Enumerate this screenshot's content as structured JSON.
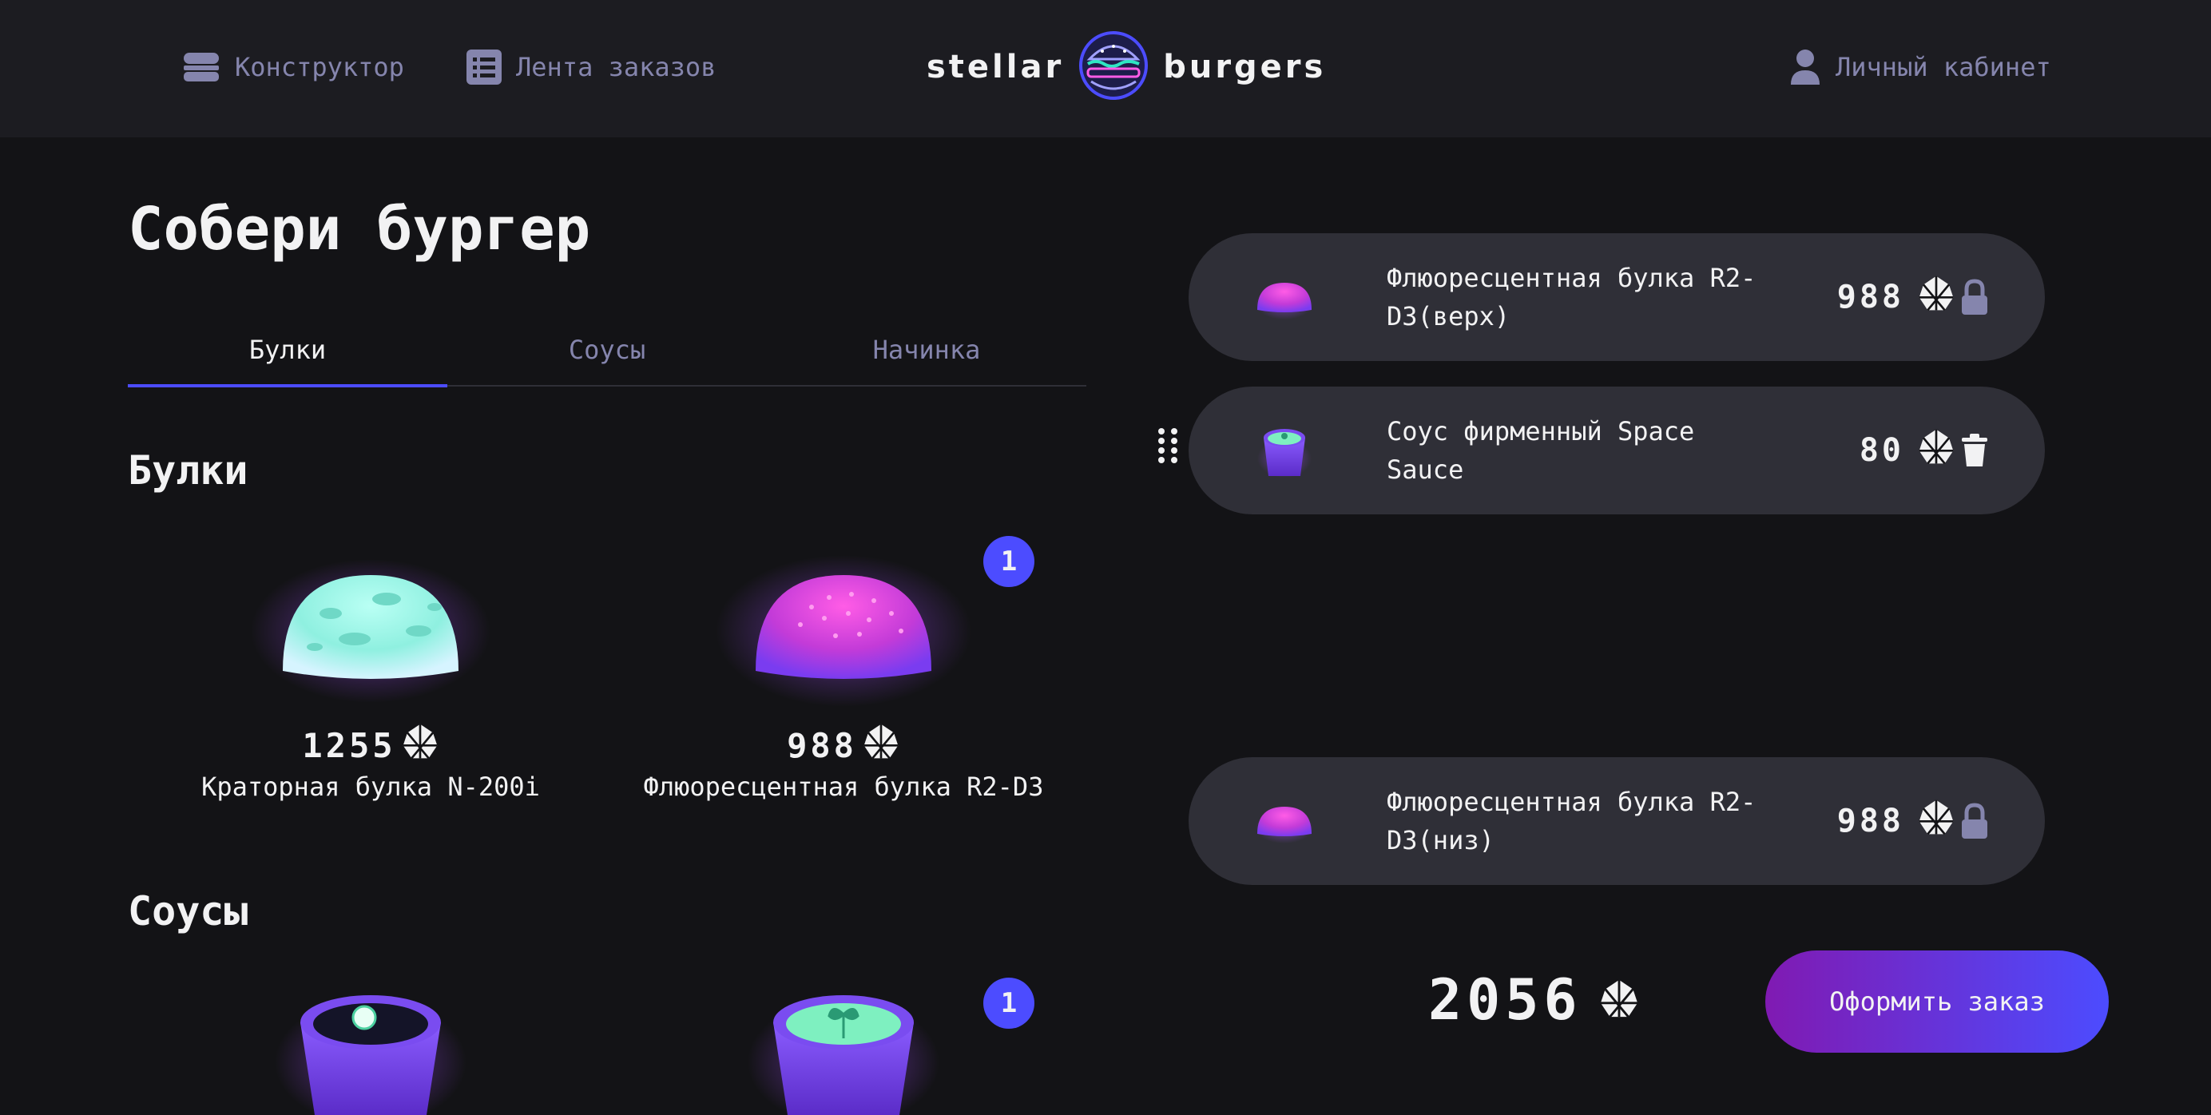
{
  "header": {
    "nav": [
      {
        "label": "Конструктор",
        "icon": "burger-icon"
      },
      {
        "label": "Лента заказов",
        "icon": "list-icon"
      }
    ],
    "logo": {
      "left": "stellar",
      "right": "burgers"
    },
    "account": {
      "label": "Личный кабинет",
      "icon": "profile-icon"
    }
  },
  "page_title": "Собери бургер",
  "tabs": [
    {
      "label": "Булки",
      "active": true
    },
    {
      "label": "Соусы",
      "active": false
    },
    {
      "label": "Начинка",
      "active": false
    }
  ],
  "sections": {
    "buns": {
      "title": "Булки",
      "items": [
        {
          "price": "1255",
          "name": "Краторная булка N-200i",
          "count": null
        },
        {
          "price": "988",
          "name": "Флюоресцентная булка R2-D3",
          "count": "1"
        }
      ]
    },
    "sauces": {
      "title": "Соусы",
      "items": [
        {
          "count": null
        },
        {
          "count": "1"
        }
      ]
    }
  },
  "constructor": {
    "top": {
      "name": "Флюоресцентная булка R2-D3(верх)",
      "price": "988",
      "action_icon": "lock-icon"
    },
    "fillings": [
      {
        "name": "Соус фирменный Space Sauce",
        "price": "80",
        "action_icon": "delete-icon"
      }
    ],
    "bottom": {
      "name": "Флюоресцентная булка R2-D3(низ)",
      "price": "988",
      "action_icon": "lock-icon"
    },
    "total": "2056",
    "order_button": "Оформить заказ"
  },
  "colors": {
    "background": "#131316",
    "header": "#1c1c21",
    "accent": "#4c4cff",
    "muted_text": "#8585ad",
    "row": "#2f2f37",
    "button_gradient_start": "#801ab2",
    "button_gradient_end": "#4c4cff"
  }
}
